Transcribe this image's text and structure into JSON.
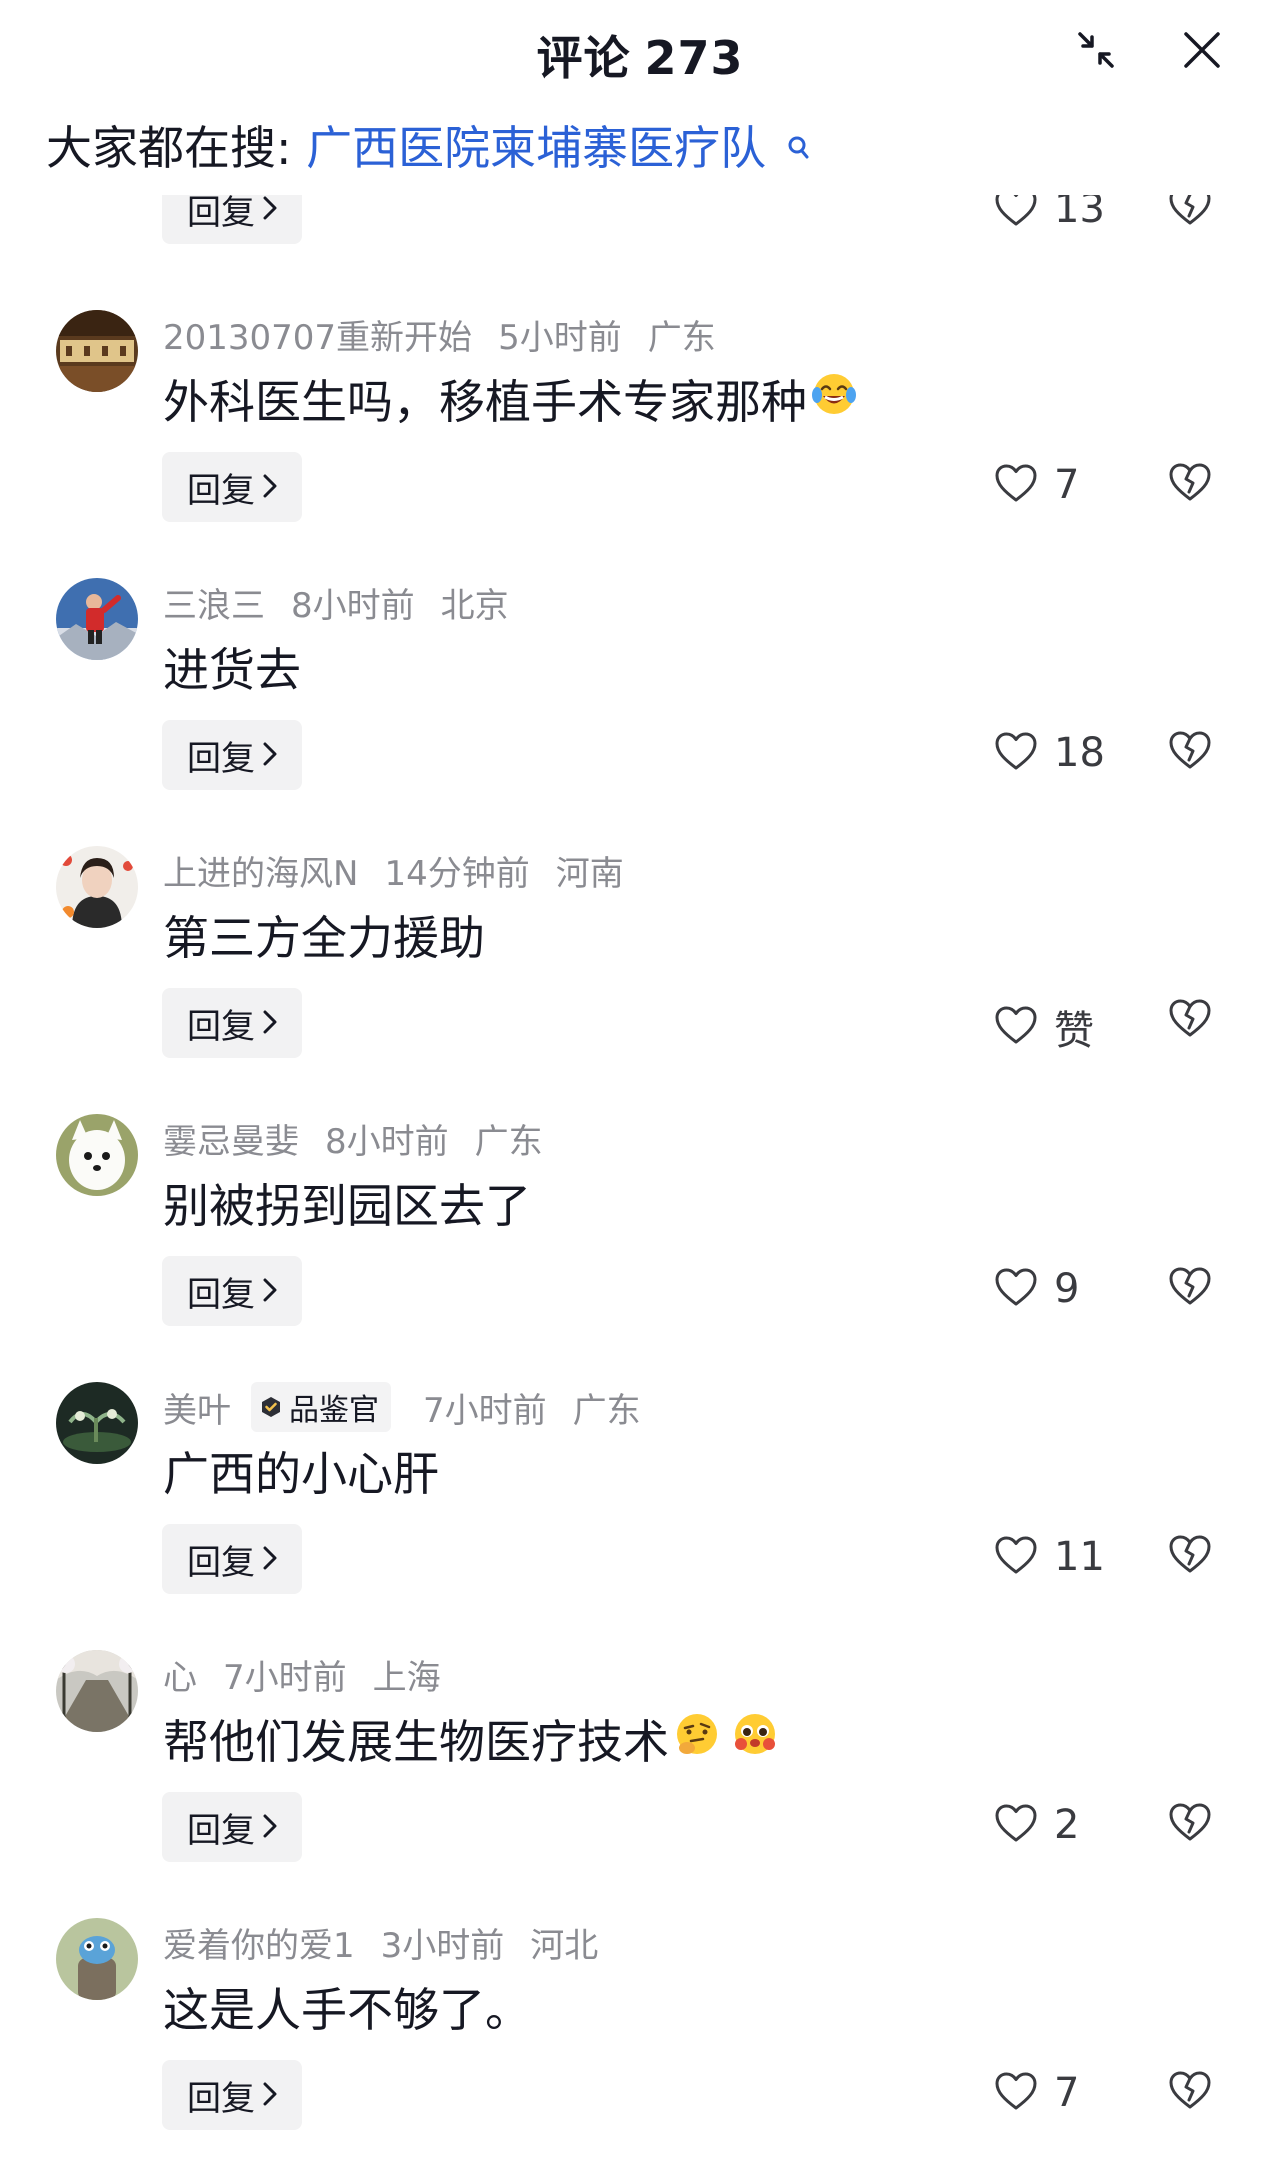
{
  "header": {
    "title": "评论",
    "count": "273"
  },
  "search_hint": {
    "label": "大家都在搜:",
    "term": "广西医院柬埔寨医疗队"
  },
  "partial_comment": {
    "reply_label": "回复",
    "like_count": "13"
  },
  "comments": [
    {
      "username": "20130707重新开始",
      "time": "5小时前",
      "location": "广东",
      "text": "外科医生吗，移植手术专家那种",
      "emoji": [
        "laughing-tears-emoji"
      ],
      "reply_label": "回复",
      "like_count": "7"
    },
    {
      "username": "三浪三",
      "time": "8小时前",
      "location": "北京",
      "text": "进货去",
      "reply_label": "回复",
      "like_count": "18"
    },
    {
      "username": "上进的海风N",
      "time": "14分钟前",
      "location": "河南",
      "text": "第三方全力援助",
      "reply_label": "回复",
      "like_count": "赞"
    },
    {
      "username": "霎忌曼婓",
      "time": "8小时前",
      "location": "广东",
      "text": "别被拐到园区去了",
      "reply_label": "回复",
      "like_count": "9"
    },
    {
      "username": "美叶",
      "badge": "品鉴官",
      "time": "7小时前",
      "location": "广东",
      "text": "广西的小心肝",
      "reply_label": "回复",
      "like_count": "11"
    },
    {
      "username": "心",
      "time": "7小时前",
      "location": "上海",
      "text": "帮他们发展生物医疗技术",
      "emoji": [
        "thinking-face-emoji",
        "pleading-face-emoji"
      ],
      "reply_label": "回复",
      "like_count": "2"
    },
    {
      "username": "爱着你的爱1",
      "time": "3小时前",
      "location": "河北",
      "text": "这是人手不够了。",
      "reply_label": "回复",
      "like_count": "7"
    }
  ],
  "colors": {
    "text": "#161823",
    "meta": "#8a8b91",
    "link": "#2b61d6",
    "reply_bg": "#f2f2f3"
  }
}
